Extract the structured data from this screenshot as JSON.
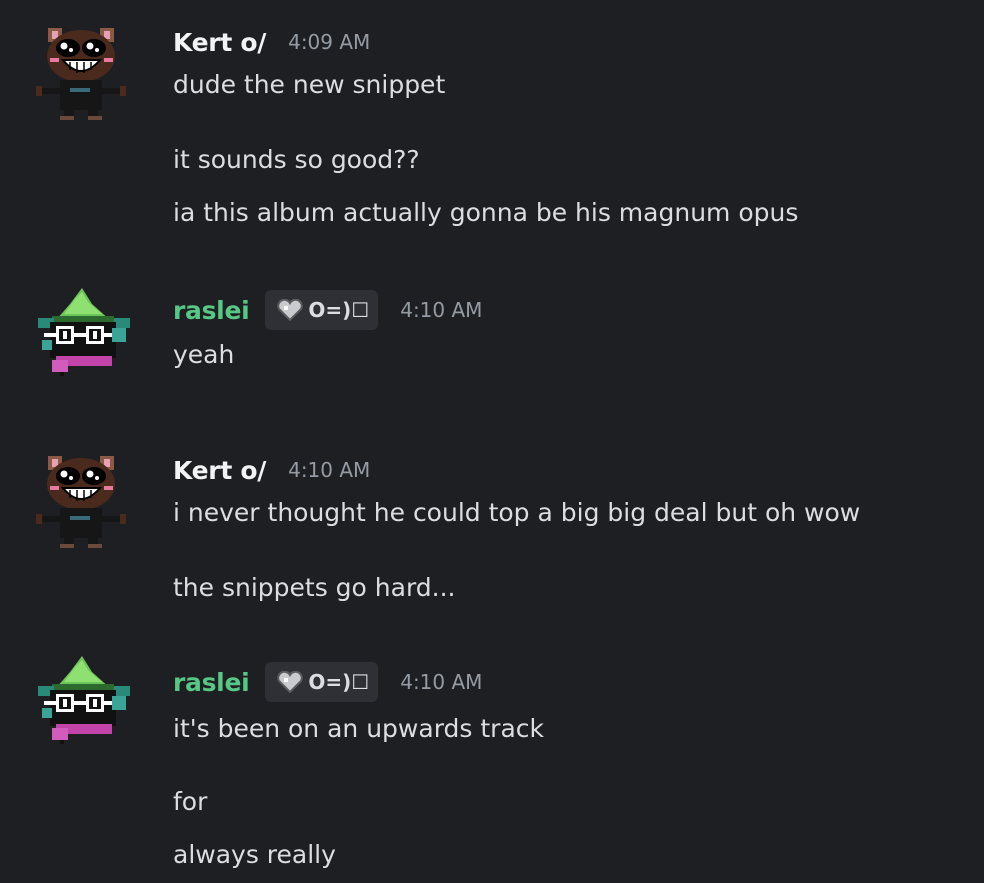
{
  "messages": [
    {
      "username": "Kert o/",
      "name_color": "#f2f3f5",
      "timestamp": "4:09 AM",
      "avatar": "kert-avatar",
      "lines": [
        "dude the new snippet",
        "it sounds so good??",
        "ia this album actually gonna be his magnum opus"
      ]
    },
    {
      "username": "raslei",
      "name_color": "#57c785",
      "tag": {
        "icon": "heart-icon",
        "text": "O=)☐"
      },
      "timestamp": "4:10 AM",
      "avatar": "ralsei-avatar",
      "lines": [
        "yeah"
      ]
    },
    {
      "username": "Kert o/",
      "name_color": "#f2f3f5",
      "timestamp": "4:10 AM",
      "avatar": "kert-avatar",
      "lines": [
        "i never thought he could top a big big deal but oh wow",
        "the snippets go hard..."
      ]
    },
    {
      "username": "raslei",
      "name_color": "#57c785",
      "tag": {
        "icon": "heart-icon",
        "text": "O=)☐"
      },
      "timestamp": "4:10 AM",
      "avatar": "ralsei-avatar",
      "lines": [
        "it's been on an upwards track",
        "for",
        "always really"
      ]
    }
  ],
  "colors": {
    "background": "#1e1f22",
    "text": "#dbdee1",
    "timestamp": "#949ba4",
    "tag_bg": "#2e3035"
  }
}
